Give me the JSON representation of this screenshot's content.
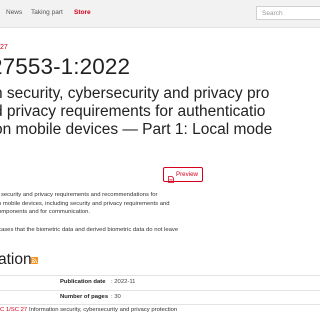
{
  "nav": {
    "news": "News",
    "taking_part": "Taking part",
    "store": "Store"
  },
  "search": {
    "placeholder": "Search"
  },
  "breadcrumb": "27",
  "standard": {
    "title": "27553-1:2022",
    "subtitle_lines": [
      "n security, cybersecurity and privacy pro",
      "d privacy requirements for authenticatio",
      "on mobile devices — Part 1: Local mode"
    ]
  },
  "preview_button": {
    "label": "Preview",
    "icon": "document-icon"
  },
  "abstract": {
    "para1": [
      "l security and privacy requirements and recommendations for",
      "n mobile devices, including security and privacy requirements and",
      "omponents and for communication."
    ],
    "para2": [
      "cases that the biometric data and derived biometric data do not leave"
    ]
  },
  "general_info": {
    "title": "ation",
    "rss_icon": "rss-icon",
    "rows": [
      {
        "label": "Publication date",
        "value": ": 2022-11"
      },
      {
        "label": "Number of pages",
        "value": ": 30"
      }
    ]
  },
  "technical_committee": {
    "code": "C 1/SC 27",
    "description": "Information security, cybersecurity and privacy protection"
  },
  "colors": {
    "accent": "#d6001c",
    "topbar_bg": "#f2f2f2",
    "rss": "#f7931e"
  }
}
